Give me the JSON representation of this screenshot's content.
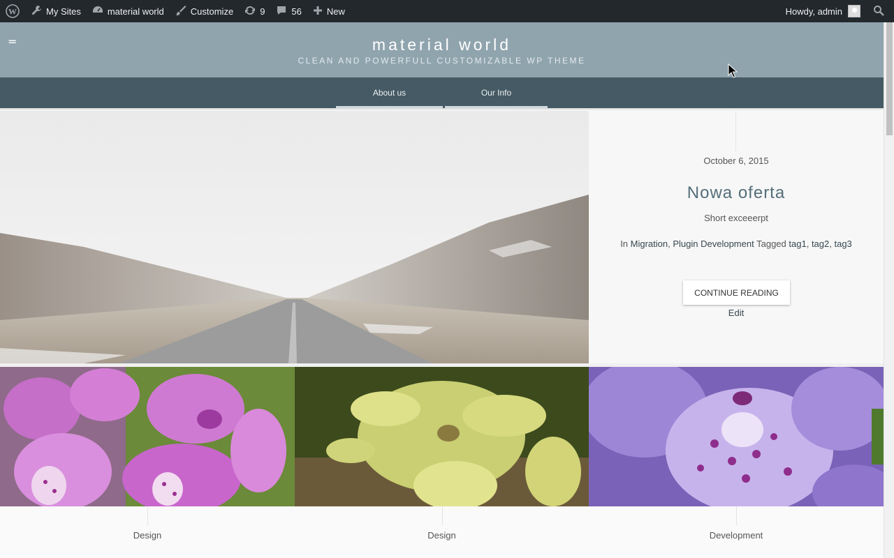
{
  "adminbar": {
    "wp_icon": "wordpress-logo-icon",
    "my_sites": "My Sites",
    "site_name": "material world",
    "customize": "Customize",
    "updates_count": "9",
    "comments_count": "56",
    "new_label": "New",
    "howdy": "Howdy, admin"
  },
  "header": {
    "site_title": "material world",
    "tagline": "CLEAN AND POWERFULL CUSTOMIZABLE WP THEME",
    "menu_toggle": "="
  },
  "nav": {
    "items": [
      {
        "label": "About us"
      },
      {
        "label": "Our Info"
      }
    ]
  },
  "featured": {
    "date": "October 6, 2015",
    "title": "Nowa oferta",
    "excerpt": "Short exceeerpt",
    "in_label": "In",
    "categories": [
      "Migration",
      "Plugin Development"
    ],
    "tagged_label": "Tagged",
    "tags": [
      "tag1",
      "tag2",
      "tag3"
    ],
    "button": "CONTINUE READING",
    "edit": "Edit"
  },
  "grid": {
    "items": [
      {
        "category": "Design"
      },
      {
        "category": "Design"
      },
      {
        "category": "Development"
      }
    ]
  },
  "colors": {
    "adminbar": "#23282d",
    "header": "#90a4ae",
    "nav": "#455a64"
  }
}
